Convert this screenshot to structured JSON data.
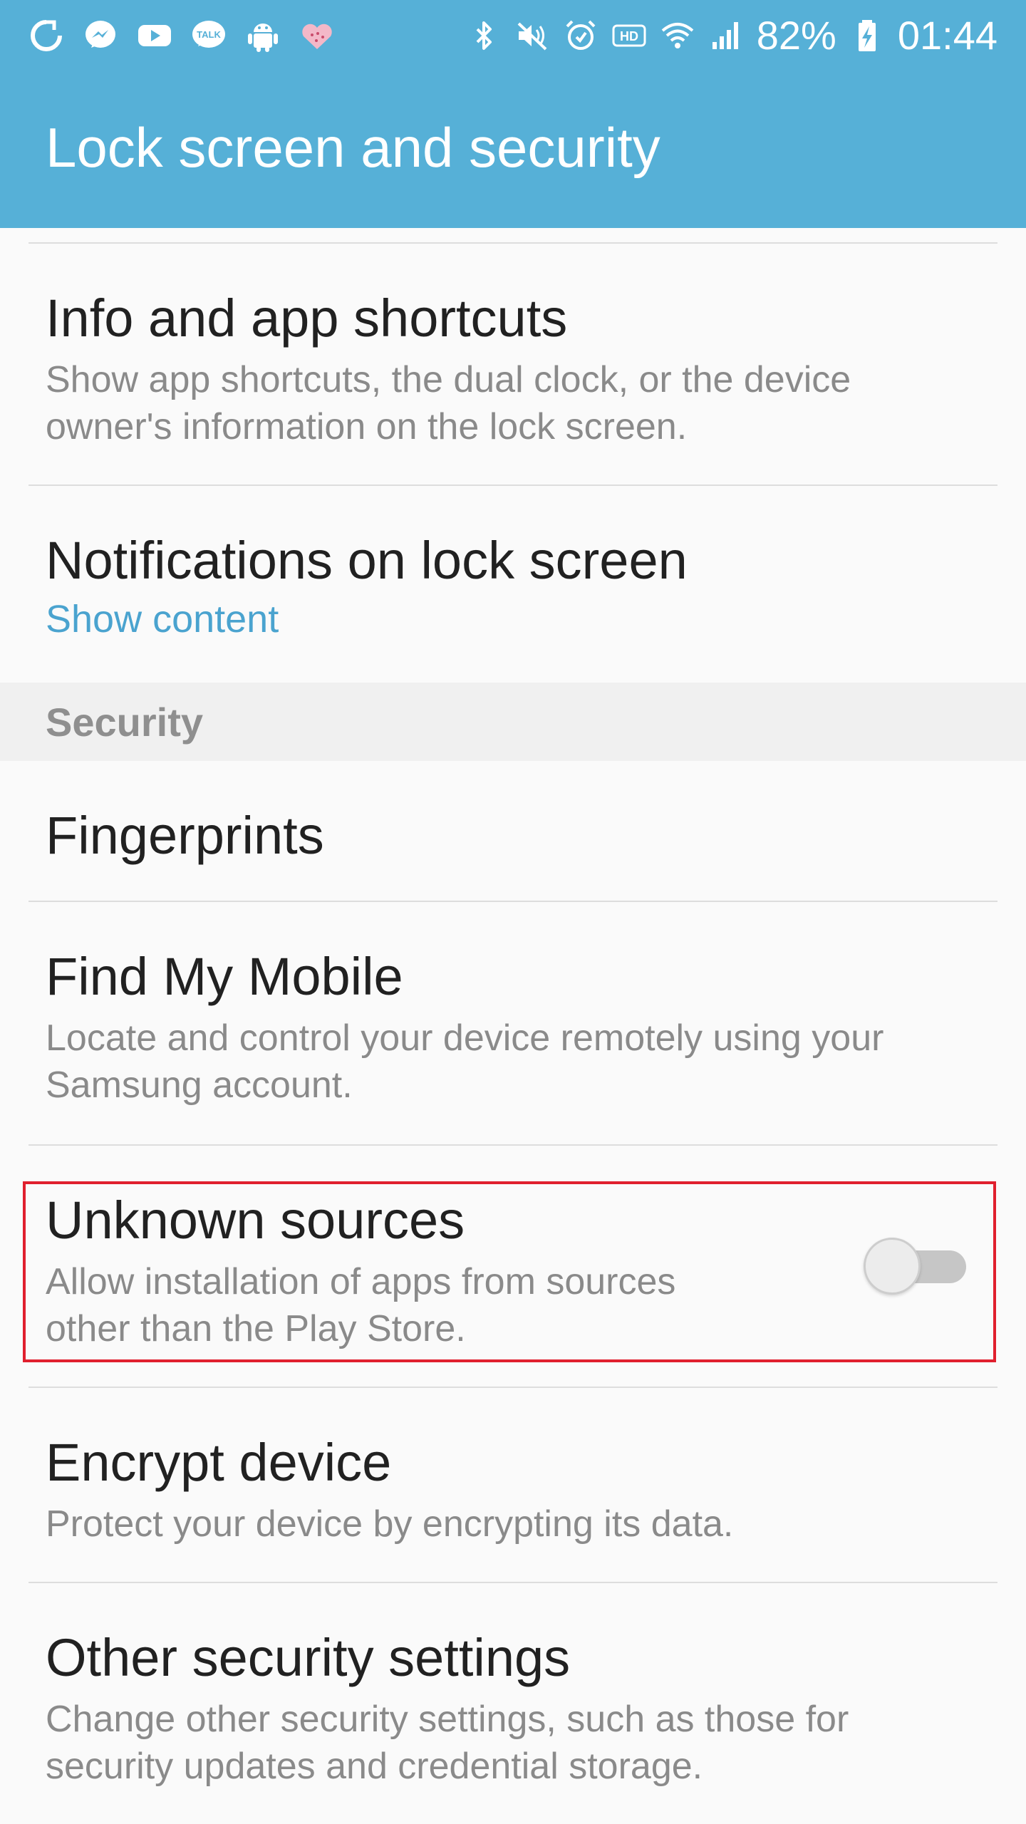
{
  "status_bar": {
    "battery": "82%",
    "time": "01:44",
    "left_icons": [
      "sync-icon",
      "messenger-icon",
      "youtube-icon",
      "kakaotalk-icon",
      "android-icon",
      "heart-app-icon"
    ],
    "right_icons": [
      "bluetooth-icon",
      "mute-icon",
      "alarm-icon",
      "hd-icon",
      "wifi-icon",
      "signal-icon",
      "battery-charging-icon"
    ]
  },
  "app_bar": {
    "title": "Lock screen and security"
  },
  "items": {
    "info_shortcuts": {
      "title": "Info and app shortcuts",
      "subtitle": "Show app shortcuts, the dual clock, or the device owner's information on the lock screen."
    },
    "notifications": {
      "title": "Notifications on lock screen",
      "value": "Show content"
    },
    "fingerprints": {
      "title": "Fingerprints"
    },
    "find_my_mobile": {
      "title": "Find My Mobile",
      "subtitle": "Locate and control your device remotely using your Samsung account."
    },
    "unknown_sources": {
      "title": "Unknown sources",
      "subtitle": "Allow installation of apps from sources other than the Play Store.",
      "enabled": false
    },
    "encrypt_device": {
      "title": "Encrypt device",
      "subtitle": "Protect your device by encrypting its data."
    },
    "other_security": {
      "title": "Other security settings",
      "subtitle": "Change other security settings, such as those for security updates and credential storage."
    }
  },
  "section": {
    "security_label": "Security"
  },
  "colors": {
    "app_bar": "#56b0d7",
    "accent_text": "#4aa3cf",
    "highlight_border": "#e0202e",
    "background": "#fafafa"
  }
}
